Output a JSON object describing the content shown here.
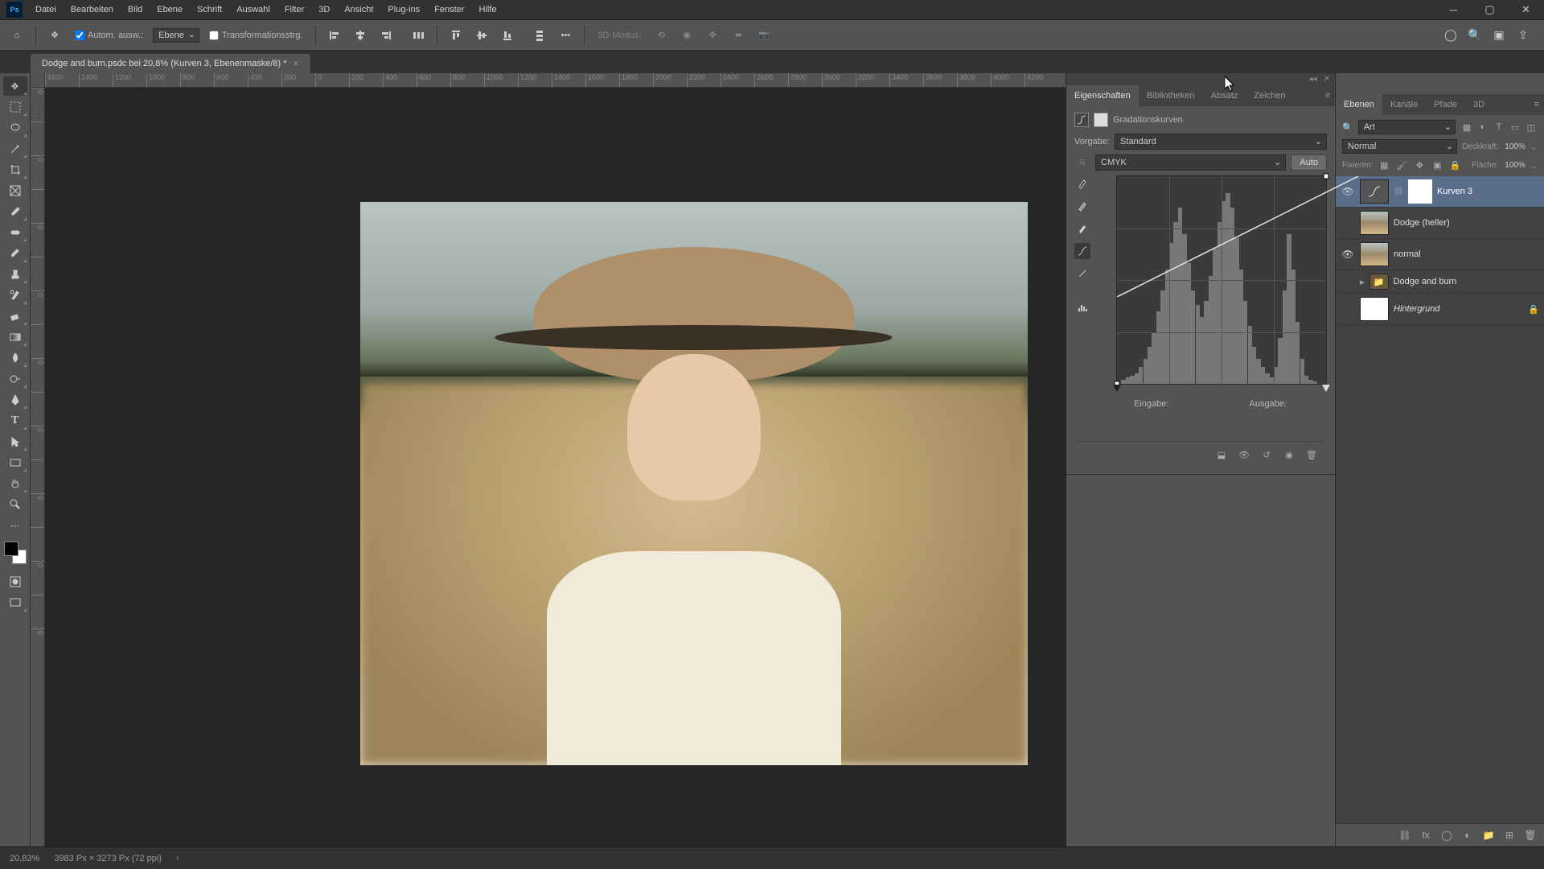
{
  "menu": [
    "Datei",
    "Bearbeiten",
    "Bild",
    "Ebene",
    "Schrift",
    "Auswahl",
    "Filter",
    "3D",
    "Ansicht",
    "Plug-ins",
    "Fenster",
    "Hilfe"
  ],
  "options": {
    "auto_select": "Autom. ausw.:",
    "layer_sel": "Ebene",
    "transform_ctrls": "Transformationsstrg.",
    "mode_3d": "3D-Modus:"
  },
  "doc_tab": "Dodge and burn.psdc bei 20,8% (Kurven 3, Ebenenmaske/8) *",
  "ruler_h": [
    "1600",
    "1400",
    "1200",
    "1000",
    "800",
    "600",
    "400",
    "200",
    "0",
    "200",
    "400",
    "600",
    "800",
    "1000",
    "1200",
    "1400",
    "1600",
    "1800",
    "2000",
    "2200",
    "2400",
    "2600",
    "2800",
    "3000",
    "3200",
    "3400",
    "3600",
    "3800",
    "4000",
    "4200"
  ],
  "ruler_v": [
    "0",
    "",
    "0",
    "",
    "0",
    "",
    "0",
    "",
    "0",
    "",
    "0",
    "",
    "0",
    "",
    "0",
    "",
    "0"
  ],
  "prop_tabs": [
    "Eigenschaften",
    "Bibliotheken",
    "Absatz",
    "Zeichen"
  ],
  "properties": {
    "title": "Gradationskurven",
    "preset_lbl": "Vorgabe:",
    "preset_val": "Standard",
    "channel": "CMYK",
    "auto": "Auto",
    "input_lbl": "Eingabe:",
    "output_lbl": "Ausgabe:"
  },
  "layer_tabs": [
    "Ebenen",
    "Kanäle",
    "Pfade",
    "3D"
  ],
  "layer_ctrl": {
    "filter": "Art",
    "blend": "Normal",
    "opacity_lbl": "Deckkraft:",
    "opacity_val": "100%",
    "lock_lbl": "Fixieren:",
    "fill_lbl": "Fläche:",
    "fill_val": "100%"
  },
  "layers": [
    {
      "name": "Kurven 3",
      "eye": true,
      "sel": true,
      "type": "adj"
    },
    {
      "name": "Dodge (heller)",
      "eye": false,
      "type": "img"
    },
    {
      "name": "normal",
      "eye": true,
      "type": "img"
    },
    {
      "name": "Dodge and burn",
      "eye": false,
      "type": "group"
    },
    {
      "name": "Hintergrund",
      "eye": false,
      "type": "bg",
      "locked": true,
      "italic": true
    }
  ],
  "status": {
    "zoom": "20,83%",
    "dims": "3983 Px × 3273 Px (72 ppi)"
  },
  "chart_data": {
    "type": "histogram_with_curve",
    "title": "Gradationskurven",
    "channel": "CMYK",
    "x_range": [
      0,
      255
    ],
    "y_range": [
      0,
      255
    ],
    "curve_points": [
      [
        0,
        0
      ],
      [
        255,
        255
      ]
    ],
    "histogram_approx_relative": [
      0,
      2,
      3,
      4,
      5,
      8,
      12,
      18,
      25,
      35,
      45,
      55,
      68,
      78,
      85,
      72,
      58,
      45,
      38,
      32,
      40,
      52,
      65,
      78,
      88,
      92,
      85,
      70,
      55,
      40,
      28,
      18,
      12,
      8,
      5,
      3,
      8,
      22,
      45,
      72,
      55,
      30,
      12,
      4,
      2,
      1,
      0,
      0
    ]
  }
}
